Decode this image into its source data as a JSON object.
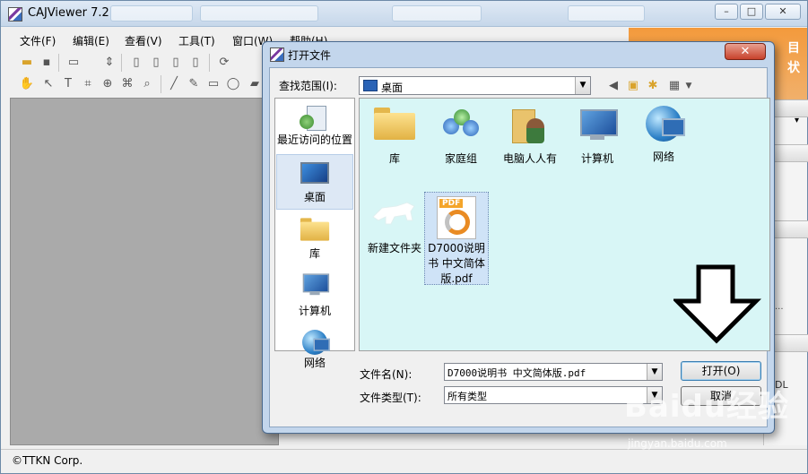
{
  "app": {
    "title": "CAJViewer 7.2"
  },
  "taskbar_blurred_tabs": [
    "",
    "",
    "",
    ""
  ],
  "window_controls": {
    "minimize": "–",
    "maximize": "□",
    "close": "✕"
  },
  "menu": [
    "文件(F)",
    "编辑(E)",
    "查看(V)",
    "工具(T)",
    "窗口(W)",
    "帮助(H)"
  ],
  "status": {
    "text": "©TTKN Corp."
  },
  "dialog": {
    "title": "打开文件",
    "close_glyph": "✕",
    "lookin_label": "查找范围(I):",
    "lookin_value": "桌面",
    "places": [
      {
        "label": "最近访问的位置",
        "icon": "recent-places-icon"
      },
      {
        "label": "桌面",
        "icon": "desktop-icon",
        "selected": true
      },
      {
        "label": "库",
        "icon": "library-icon"
      },
      {
        "label": "计算机",
        "icon": "computer-icon"
      },
      {
        "label": "网络",
        "icon": "network-icon"
      }
    ],
    "files": [
      {
        "label": "库",
        "icon": "library-folder-icon"
      },
      {
        "label": "家庭组",
        "icon": "homegroup-icon"
      },
      {
        "label": "电脑人人有",
        "icon": "user-folder-icon"
      },
      {
        "label": "计算机",
        "icon": "computer-icon"
      },
      {
        "label": "网络",
        "icon": "network-icon"
      },
      {
        "label": "新建文件夹",
        "icon": "folder-icon"
      },
      {
        "label": "D7000说明书 中文简体版.pdf",
        "icon": "pdf-file-icon",
        "selected": true
      }
    ],
    "filename_label": "文件名(N):",
    "filename_value": "D7000说明书 中文简体版.pdf",
    "filetype_label": "文件类型(T):",
    "filetype_value": "所有类型",
    "open_button": "打开(O)",
    "cancel_button": "取消"
  },
  "side_panel_glyphs": {
    "dropdown": "▾",
    "dots": "...",
    "dl": "DL"
  },
  "watermark": {
    "text": "Baidu经验",
    "sub": "jingyan.baidu.com"
  },
  "banner": {
    "line1": "目",
    "line2": "状"
  },
  "colors": {
    "file_view_bg": "#d8f6f6",
    "title_bar": "#c6d7ea",
    "doc_area": "#aaaaaa",
    "dialog_close": "#c7422b"
  }
}
